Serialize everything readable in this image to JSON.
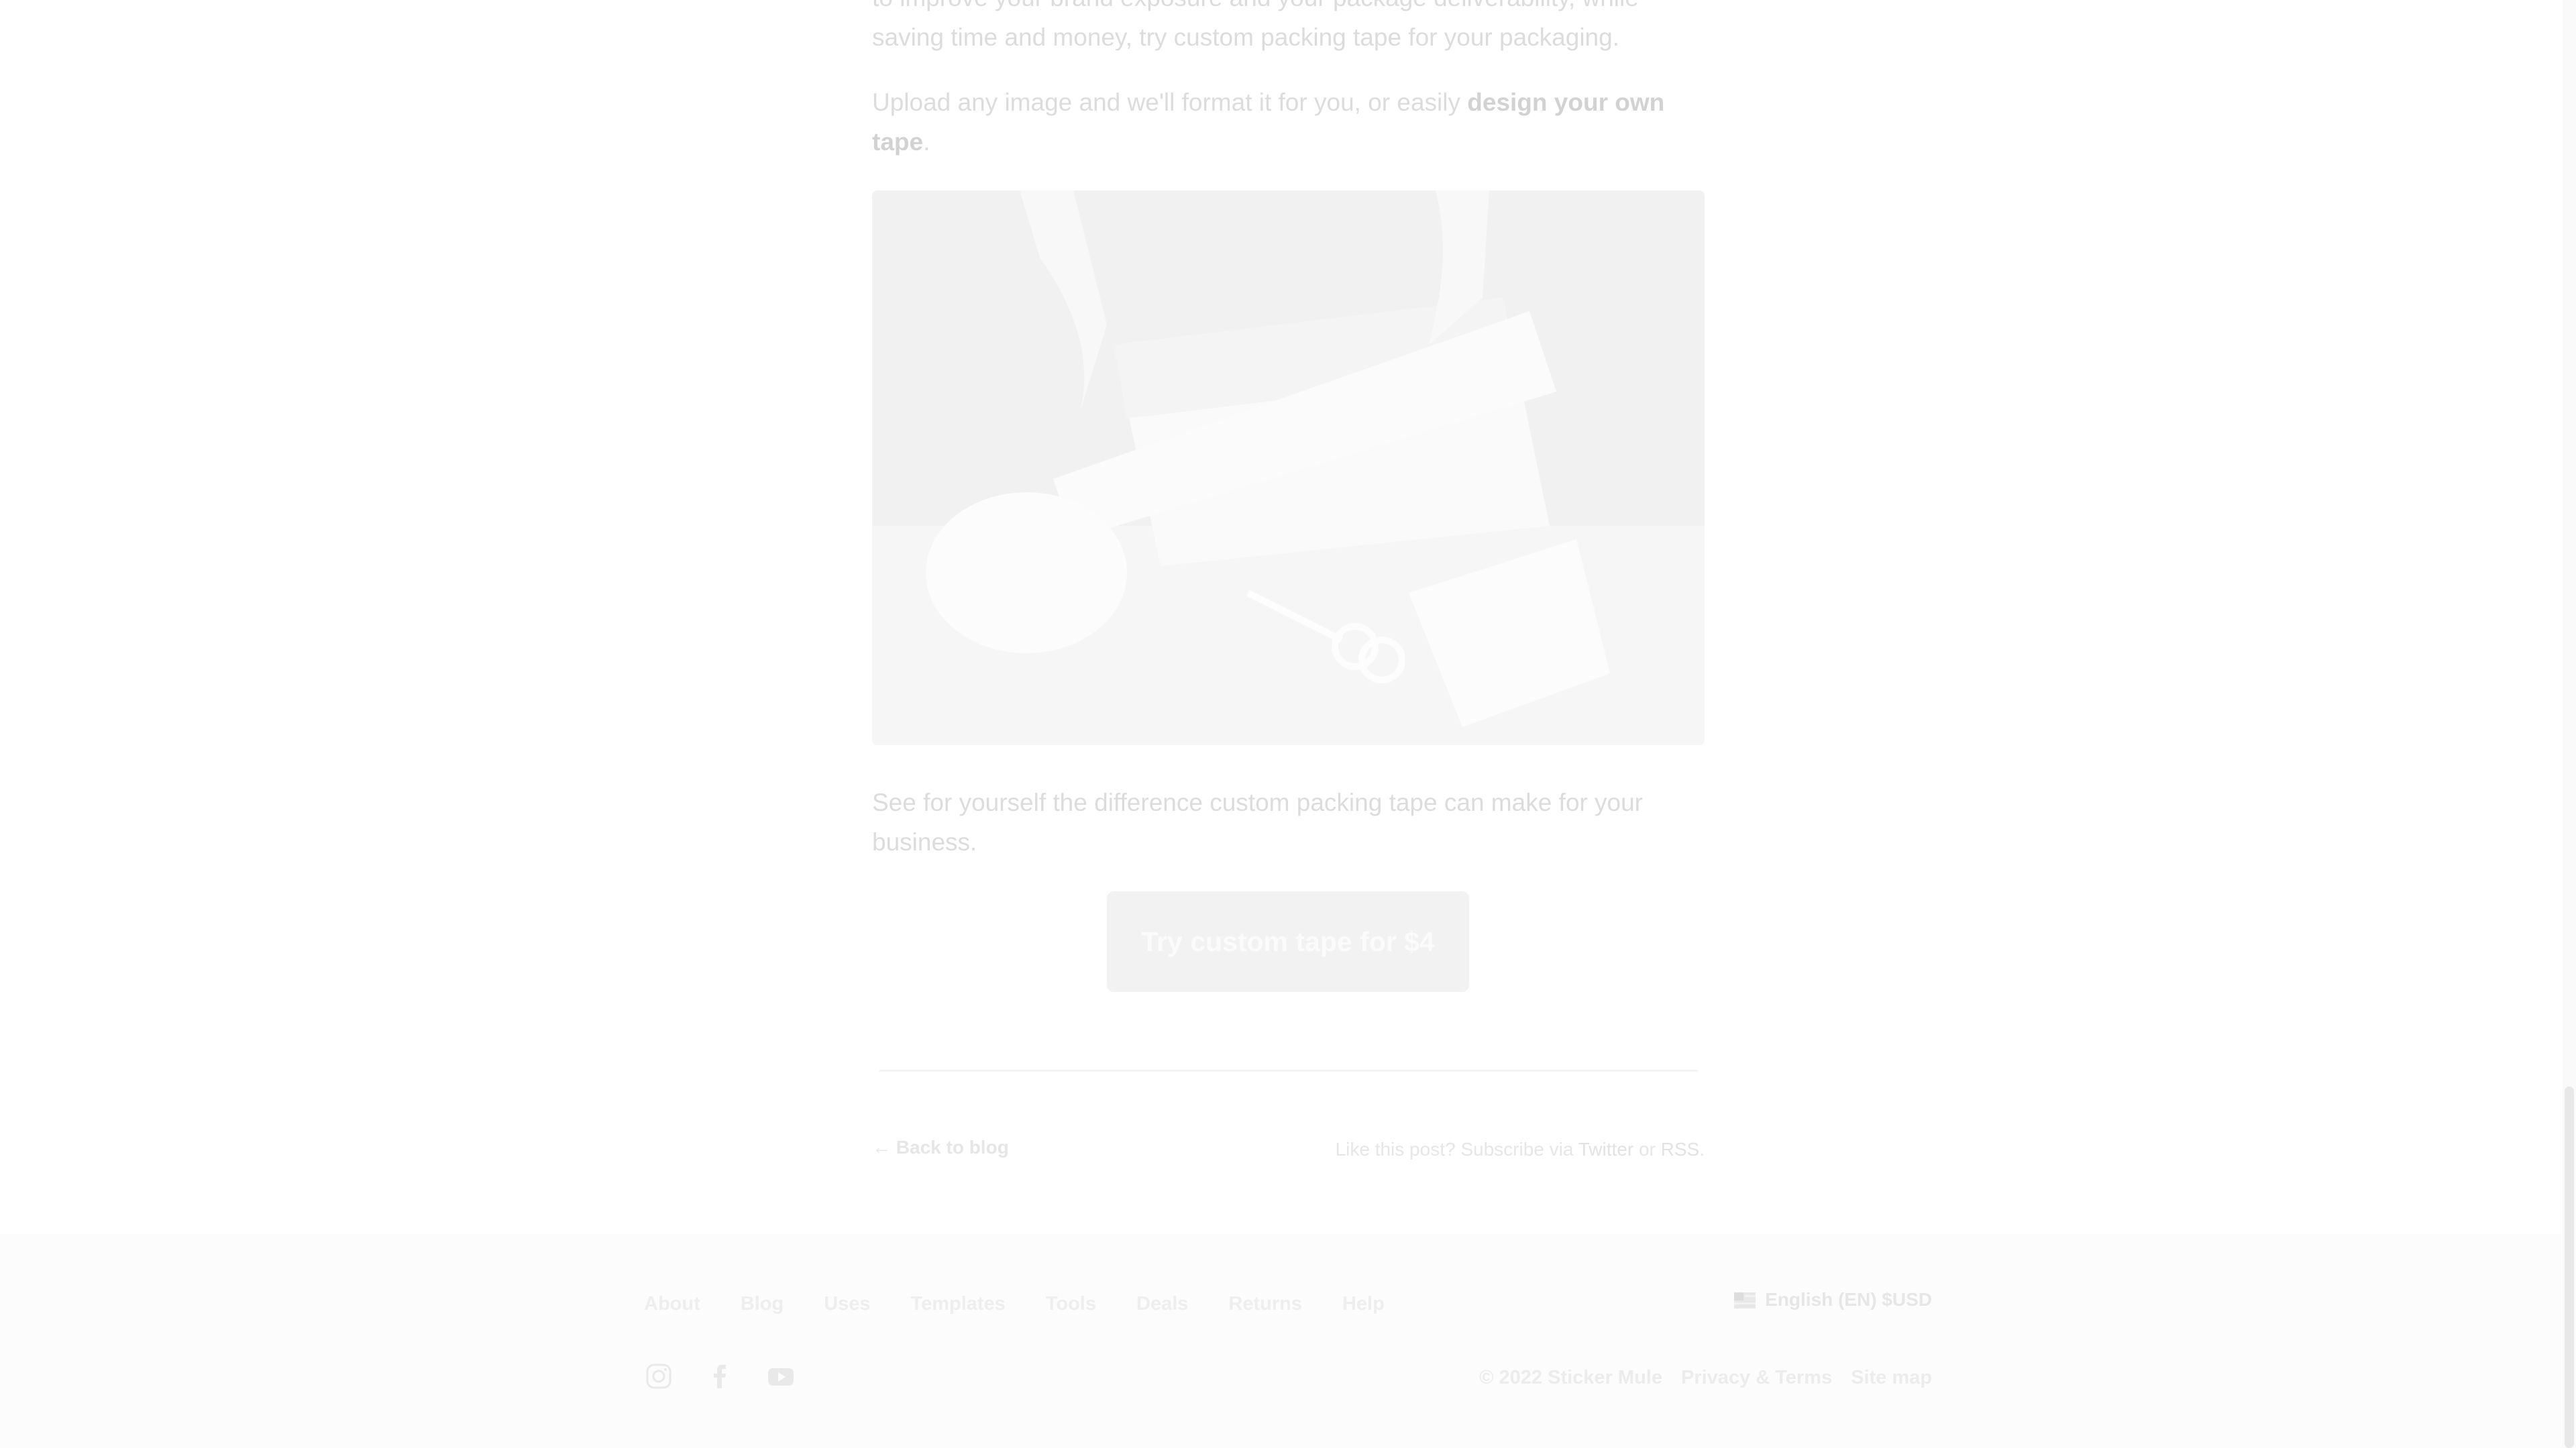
{
  "article": {
    "para1": "to improve your brand exposure and your package deliverability, while saving time and money, try custom packing tape for your packaging.",
    "para2_prefix": "Upload any image and we'll format it for you, or easily ",
    "para2_strong": "design your own tape",
    "para2_suffix": ".",
    "para3": "See for yourself the difference custom packing tape can make for your business.",
    "cta_label": "Try custom tape for $4"
  },
  "post_nav": {
    "back_label": "← Back to blog",
    "subscribe_prefix": "Like this post? Subscribe via ",
    "twitter_label": "Twitter",
    "or_text": " or ",
    "rss_label": "RSS",
    "period": "."
  },
  "footer": {
    "nav": [
      "About",
      "Blog",
      "Uses",
      "Templates",
      "Tools",
      "Deals",
      "Returns",
      "Help"
    ],
    "language": "English (EN) $USD",
    "copyright": "© 2022 Sticker Mule",
    "privacy_label": "Privacy & Terms",
    "sitemap_label": "Site map",
    "social_icons": [
      "instagram-icon",
      "facebook-icon",
      "youtube-icon"
    ]
  },
  "colors": {
    "text_faded": "#dcdcdc",
    "button_bg": "#f2f2f2",
    "footer_bg": "#fcfcfc"
  }
}
